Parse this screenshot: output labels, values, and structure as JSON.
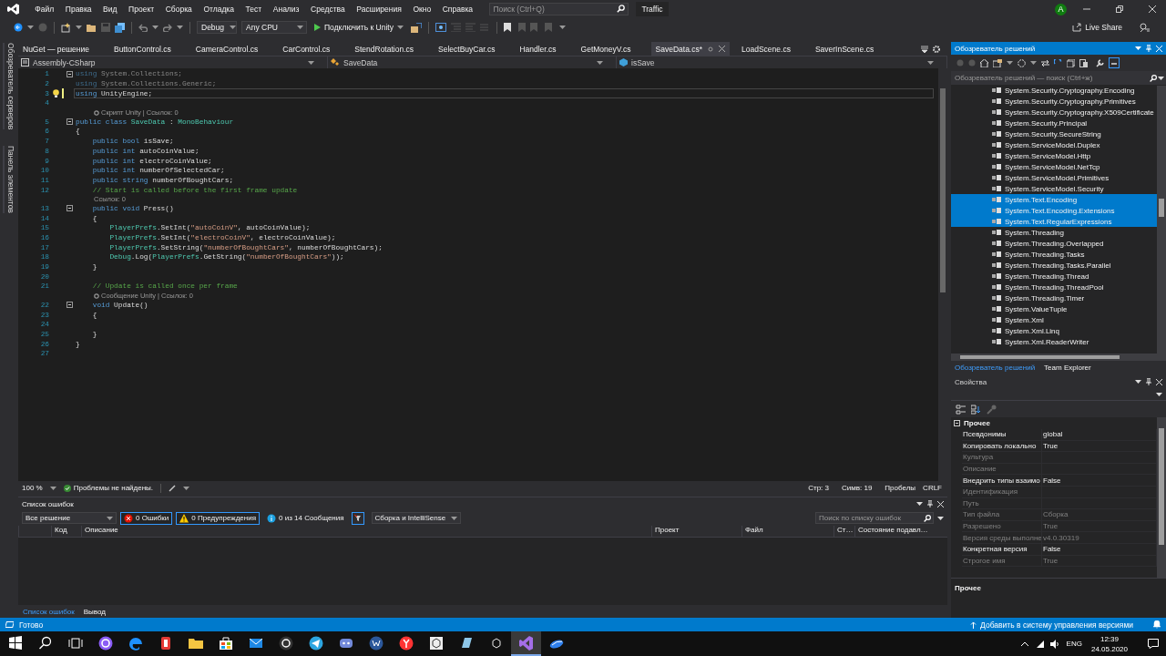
{
  "menubar": {
    "items": [
      "Файл",
      "Правка",
      "Вид",
      "Проект",
      "Сборка",
      "Отладка",
      "Тест",
      "Анализ",
      "Средства",
      "Расширения",
      "Окно",
      "Справка"
    ],
    "search": {
      "placeholder": "Поиск (Ctrl+Q)"
    },
    "solution_name": "Traffic",
    "avatar": "A"
  },
  "toolbar": {
    "configuration": "Debug",
    "platform": "Any CPU",
    "run": "Подключить к Unity",
    "live_share": "Live Share"
  },
  "side_strip": [
    "Обозреватель серверов",
    "Панель элементов"
  ],
  "editor": {
    "tabs": [
      {
        "label": "NuGet — решение",
        "selected": false
      },
      {
        "label": "ButtonControl.cs",
        "selected": false
      },
      {
        "label": "CameraControl.cs",
        "selected": false
      },
      {
        "label": "CarControl.cs",
        "selected": false
      },
      {
        "label": "StendRotation.cs",
        "selected": false
      },
      {
        "label": "SelectBuyCar.cs",
        "selected": false
      },
      {
        "label": "Handler.cs",
        "selected": false
      },
      {
        "label": "GetMoneyV.cs",
        "selected": false
      },
      {
        "label": "SaveData.cs*",
        "selected": true
      },
      {
        "label": "LoadScene.cs",
        "selected": false
      },
      {
        "label": "SaverInScene.cs",
        "selected": false
      }
    ],
    "navbar": {
      "project": "Assembly-CSharp",
      "class": "SaveData",
      "member": "isSave"
    },
    "lines": [
      {
        "kind": "code",
        "number": "1",
        "fold": true,
        "changed": false,
        "current": false,
        "bulb": false,
        "tokens": [
          {
            "kind": "dimkw",
            "text": "using"
          },
          {
            "kind": "dim",
            "text": " System.Collections;"
          }
        ]
      },
      {
        "kind": "code",
        "number": "2",
        "fold": false,
        "changed": false,
        "current": false,
        "bulb": false,
        "tokens": [
          {
            "kind": "dimkw",
            "text": "using"
          },
          {
            "kind": "dim",
            "text": " System.Collections.Generic;"
          }
        ]
      },
      {
        "kind": "code",
        "number": "3",
        "fold": false,
        "changed": true,
        "current": true,
        "bulb": true,
        "tokens": [
          {
            "kind": "kw",
            "text": "using"
          },
          {
            "kind": "plain",
            "text": " UnityEngine;"
          }
        ]
      },
      {
        "kind": "code",
        "number": "4",
        "fold": false,
        "changed": false,
        "current": false,
        "bulb": false
      },
      {
        "kind": "codelens",
        "text": "Скрипт Unity | Ссылок: 0",
        "icon": true
      },
      {
        "kind": "code",
        "number": "5",
        "fold": true,
        "changed": false,
        "current": false,
        "bulb": false,
        "tokens": [
          {
            "kind": "kw",
            "text": "public class"
          },
          {
            "kind": "type",
            "text": " SaveData"
          },
          {
            "kind": "plain",
            "text": " : "
          },
          {
            "kind": "type",
            "text": "MonoBehaviour"
          }
        ]
      },
      {
        "kind": "code",
        "number": "6",
        "fold": false,
        "changed": false,
        "current": false,
        "bulb": false,
        "tokens": [
          {
            "kind": "plain",
            "text": "{"
          }
        ]
      },
      {
        "kind": "code",
        "number": "7",
        "fold": false,
        "changed": false,
        "current": false,
        "bulb": false,
        "tokens": [
          {
            "kind": "kw",
            "text": "    public bool"
          },
          {
            "kind": "plain",
            "text": " isSave;"
          }
        ]
      },
      {
        "kind": "code",
        "number": "8",
        "fold": false,
        "changed": false,
        "current": false,
        "bulb": false,
        "tokens": [
          {
            "kind": "kw",
            "text": "    public int"
          },
          {
            "kind": "plain",
            "text": " autoCoinValue;"
          }
        ]
      },
      {
        "kind": "code",
        "number": "9",
        "fold": false,
        "changed": false,
        "current": false,
        "bulb": false,
        "tokens": [
          {
            "kind": "kw",
            "text": "    public int"
          },
          {
            "kind": "plain",
            "text": " electroCoinValue;"
          }
        ]
      },
      {
        "kind": "code",
        "number": "10",
        "fold": false,
        "changed": false,
        "current": false,
        "bulb": false,
        "tokens": [
          {
            "kind": "kw",
            "text": "    public int"
          },
          {
            "kind": "plain",
            "text": " numberOfSelectedCar;"
          }
        ]
      },
      {
        "kind": "code",
        "number": "11",
        "fold": false,
        "changed": false,
        "current": false,
        "bulb": false,
        "tokens": [
          {
            "kind": "kw",
            "text": "    public string"
          },
          {
            "kind": "plain",
            "text": " numberOfBoughtCars;"
          }
        ]
      },
      {
        "kind": "code",
        "number": "12",
        "fold": false,
        "changed": false,
        "current": false,
        "bulb": false,
        "tokens": [
          {
            "kind": "cmt",
            "text": "    // Start is called before the first frame update"
          }
        ]
      },
      {
        "kind": "codelens",
        "text": "Ссылок: 0",
        "icon": false
      },
      {
        "kind": "code",
        "number": "13",
        "fold": true,
        "changed": false,
        "current": false,
        "bulb": false,
        "tokens": [
          {
            "kind": "kw",
            "text": "    public void"
          },
          {
            "kind": "plain",
            "text": " Press()"
          }
        ]
      },
      {
        "kind": "code",
        "number": "14",
        "fold": false,
        "changed": false,
        "current": false,
        "bulb": false,
        "tokens": [
          {
            "kind": "plain",
            "text": "    {"
          }
        ]
      },
      {
        "kind": "code",
        "number": "15",
        "fold": false,
        "changed": false,
        "current": false,
        "bulb": false,
        "tokens": [
          {
            "kind": "type",
            "text": "        PlayerPrefs"
          },
          {
            "kind": "plain",
            "text": ".SetInt("
          },
          {
            "kind": "str",
            "text": "\"autoCoinV\""
          },
          {
            "kind": "plain",
            "text": ", autoCoinValue);"
          }
        ]
      },
      {
        "kind": "code",
        "number": "16",
        "fold": false,
        "changed": false,
        "current": false,
        "bulb": false,
        "tokens": [
          {
            "kind": "type",
            "text": "        PlayerPrefs"
          },
          {
            "kind": "plain",
            "text": ".SetInt("
          },
          {
            "kind": "str",
            "text": "\"electroCoinV\""
          },
          {
            "kind": "plain",
            "text": ", electroCoinValue);"
          }
        ]
      },
      {
        "kind": "code",
        "number": "17",
        "fold": false,
        "changed": false,
        "current": false,
        "bulb": false,
        "tokens": [
          {
            "kind": "type",
            "text": "        PlayerPrefs"
          },
          {
            "kind": "plain",
            "text": ".SetString("
          },
          {
            "kind": "str",
            "text": "\"numberOfBoughtCars\""
          },
          {
            "kind": "plain",
            "text": ", numberOfBoughtCars);"
          }
        ]
      },
      {
        "kind": "code",
        "number": "18",
        "fold": false,
        "changed": false,
        "current": false,
        "bulb": false,
        "tokens": [
          {
            "kind": "type",
            "text": "        Debug"
          },
          {
            "kind": "plain",
            "text": ".Log("
          },
          {
            "kind": "type",
            "text": "PlayerPrefs"
          },
          {
            "kind": "plain",
            "text": ".GetString("
          },
          {
            "kind": "str",
            "text": "\"numberOfBoughtCars\""
          },
          {
            "kind": "plain",
            "text": "));"
          }
        ]
      },
      {
        "kind": "code",
        "number": "19",
        "fold": false,
        "changed": false,
        "current": false,
        "bulb": false,
        "tokens": [
          {
            "kind": "plain",
            "text": "    }"
          }
        ]
      },
      {
        "kind": "code",
        "number": "20",
        "fold": false,
        "changed": false,
        "current": false,
        "bulb": false
      },
      {
        "kind": "code",
        "number": "21",
        "fold": false,
        "changed": false,
        "current": false,
        "bulb": false,
        "tokens": [
          {
            "kind": "cmt",
            "text": "    // Update is called once per frame"
          }
        ]
      },
      {
        "kind": "codelens",
        "text": "Сообщение Unity | Ссылок: 0",
        "icon": true
      },
      {
        "kind": "code",
        "number": "22",
        "fold": true,
        "changed": false,
        "current": false,
        "bulb": false,
        "tokens": [
          {
            "kind": "kw",
            "text": "    void"
          },
          {
            "kind": "plain",
            "text": " Update()"
          }
        ]
      },
      {
        "kind": "code",
        "number": "23",
        "fold": false,
        "changed": false,
        "current": false,
        "bulb": false,
        "tokens": [
          {
            "kind": "plain",
            "text": "    {"
          }
        ]
      },
      {
        "kind": "code",
        "number": "24",
        "fold": false,
        "changed": false,
        "current": false,
        "bulb": false
      },
      {
        "kind": "code",
        "number": "25",
        "fold": false,
        "changed": false,
        "current": false,
        "bulb": false,
        "tokens": [
          {
            "kind": "plain",
            "text": "    }"
          }
        ]
      },
      {
        "kind": "code",
        "number": "26",
        "fold": false,
        "changed": false,
        "current": false,
        "bulb": false,
        "tokens": [
          {
            "kind": "plain",
            "text": "}"
          }
        ]
      },
      {
        "kind": "code",
        "number": "27",
        "fold": false,
        "changed": false,
        "current": false,
        "bulb": false
      }
    ],
    "status": {
      "zoom": "100 %",
      "issues": "Проблемы не найдены.",
      "line": "Стр: 3",
      "column": "Симв: 19",
      "indent": "Пробелы",
      "line_endings": "CRLF"
    }
  },
  "error_list": {
    "title": "Список ошибок",
    "scope": "Все решение",
    "filters": [
      {
        "kind": "error",
        "label": "0 Ошибки",
        "on": true
      },
      {
        "kind": "warning",
        "label": "0 Предупреждения",
        "on": true
      },
      {
        "kind": "info",
        "label": "0 из 14 Сообщения",
        "on": false
      }
    ],
    "source": "Сборка и IntelliSense",
    "search": {
      "placeholder": "Поиск по списку ошибок"
    },
    "columns": [
      "Код",
      "Описание",
      "Проект",
      "Файл",
      "Ст…",
      "Состояние подавл…"
    ],
    "tabs": [
      {
        "label": "Список ошибок",
        "selected": true
      },
      {
        "label": "Вывод",
        "selected": false
      }
    ]
  },
  "solution_explorer": {
    "title": "Обозреватель решений",
    "search": {
      "placeholder": "Обозреватель решений — поиск (Ctrl+ж)"
    },
    "items": [
      {
        "label": "System.Security.Cryptography.Encoding",
        "selected": false
      },
      {
        "label": "System.Security.Cryptography.Primitives",
        "selected": false
      },
      {
        "label": "System.Security.Cryptography.X509Certificate",
        "selected": false
      },
      {
        "label": "System.Security.Principal",
        "selected": false
      },
      {
        "label": "System.Security.SecureString",
        "selected": false
      },
      {
        "label": "System.ServiceModel.Duplex",
        "selected": false
      },
      {
        "label": "System.ServiceModel.Http",
        "selected": false
      },
      {
        "label": "System.ServiceModel.NetTcp",
        "selected": false
      },
      {
        "label": "System.ServiceModel.Primitives",
        "selected": false
      },
      {
        "label": "System.ServiceModel.Security",
        "selected": false
      },
      {
        "label": "System.Text.Encoding",
        "selected": true
      },
      {
        "label": "System.Text.Encoding.Extensions",
        "selected": true
      },
      {
        "label": "System.Text.RegularExpressions",
        "selected": true
      },
      {
        "label": "System.Threading",
        "selected": false
      },
      {
        "label": "System.Threading.Overlapped",
        "selected": false
      },
      {
        "label": "System.Threading.Tasks",
        "selected": false
      },
      {
        "label": "System.Threading.Tasks.Parallel",
        "selected": false
      },
      {
        "label": "System.Threading.Thread",
        "selected": false
      },
      {
        "label": "System.Threading.ThreadPool",
        "selected": false
      },
      {
        "label": "System.Threading.Timer",
        "selected": false
      },
      {
        "label": "System.ValueTuple",
        "selected": false
      },
      {
        "label": "System.Xml",
        "selected": false
      },
      {
        "label": "System.Xml.Linq",
        "selected": false
      },
      {
        "label": "System.Xml.ReaderWriter",
        "selected": false
      }
    ],
    "tabs": [
      {
        "label": "Обозреватель решений",
        "selected": true
      },
      {
        "label": "Team Explorer",
        "selected": false
      }
    ]
  },
  "properties": {
    "title": "Свойства",
    "category": "Прочее",
    "rows": [
      {
        "name": "Псевдонимы",
        "value": "global",
        "disabled": false
      },
      {
        "name": "Копировать локально",
        "value": "True",
        "disabled": false
      },
      {
        "name": "Культура",
        "disabled": true
      },
      {
        "name": "Описание",
        "disabled": true
      },
      {
        "name": "Внедрить типы взаимо",
        "value": "False",
        "disabled": false
      },
      {
        "name": "Идентификация",
        "disabled": true
      },
      {
        "name": "Путь",
        "disabled": true
      },
      {
        "name": "Тип файла",
        "value": "Сборка",
        "disabled": true
      },
      {
        "name": "Разрешено",
        "value": "True",
        "disabled": true
      },
      {
        "name": "Версия среды выполне",
        "value": "v4.0.30319",
        "disabled": true
      },
      {
        "name": "Конкретная версия",
        "value": "False",
        "disabled": false
      },
      {
        "name": "Строгое имя",
        "value": "True",
        "disabled": true
      }
    ],
    "description": "Прочее"
  },
  "status_bar": {
    "state": "Готово",
    "source_control": "Добавить в систему управления версиями"
  },
  "taskbar": {
    "apps": [
      {
        "kind": "start",
        "active": false
      },
      {
        "kind": "search",
        "active": false
      },
      {
        "kind": "taskview",
        "active": false
      },
      {
        "kind": "ring",
        "active": false
      },
      {
        "kind": "edge",
        "active": false
      },
      {
        "kind": "red",
        "active": false
      },
      {
        "kind": "folder",
        "active": false
      },
      {
        "kind": "store",
        "active": false
      },
      {
        "kind": "mail",
        "active": false
      },
      {
        "kind": "circle",
        "active": false
      },
      {
        "kind": "plane",
        "active": false
      },
      {
        "kind": "chat",
        "active": false
      },
      {
        "kind": "doc",
        "active": false
      },
      {
        "kind": "redcircle",
        "active": false
      },
      {
        "kind": "cube",
        "active": false
      },
      {
        "kind": "tile",
        "active": false
      },
      {
        "kind": "cubedark",
        "active": false
      },
      {
        "kind": "ribbon",
        "active": true
      },
      {
        "kind": "swoosh",
        "active": false
      }
    ],
    "language": "ENG",
    "time": "12:39",
    "date": "24.05.2020"
  }
}
